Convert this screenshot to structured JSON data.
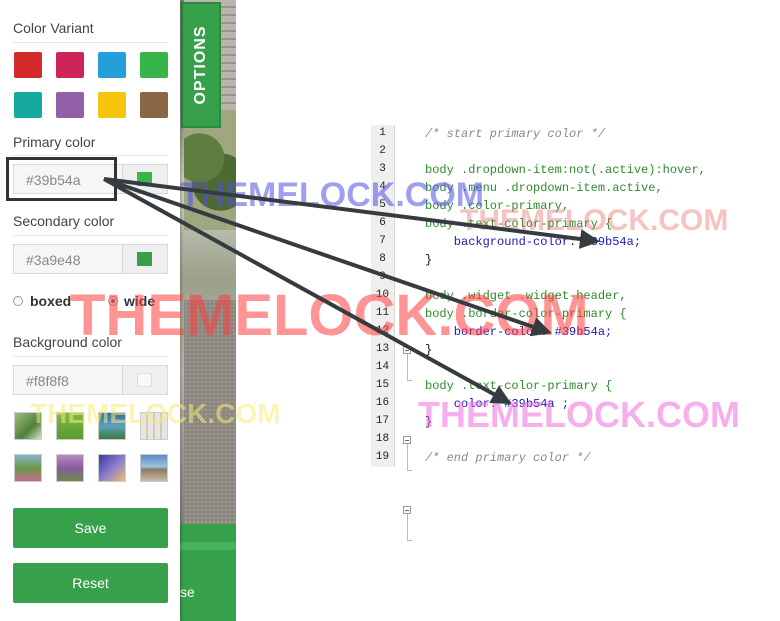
{
  "options_tab": {
    "label": "OPTIONS"
  },
  "panel": {
    "color_variant_title": "Color Variant",
    "swatches": [
      "#d42a2a",
      "#cf2457",
      "#23a0dc",
      "#36b54a",
      "#16a9a0",
      "#935fa6",
      "#f5c40c",
      "#8b6645"
    ],
    "primary": {
      "title": "Primary color",
      "value": "#39b54a",
      "chip": "#39b54a"
    },
    "secondary": {
      "title": "Secondary color",
      "value": "#3a9e48",
      "chip": "#3a9e48"
    },
    "layout": {
      "boxed_label": "boxed",
      "wide_label": "wide",
      "selected": "wide"
    },
    "background": {
      "title": "Background color",
      "value": "#f8f8f8",
      "chip": "#f8f8f8"
    },
    "save_label": "Save",
    "reset_label": "Reset"
  },
  "background_bottom_text": "se",
  "watermark": "THEMELOCK.COM",
  "code": {
    "lines": [
      {
        "n": "1",
        "t": "/* start primary color */"
      },
      {
        "n": "2",
        "t": ""
      },
      {
        "n": "3",
        "t": "body .dropdown-item:not(.active):hover,"
      },
      {
        "n": "4",
        "t": "body .menu .dropdown-item.active,"
      },
      {
        "n": "5",
        "t": "body .color-primary,"
      },
      {
        "n": "6",
        "t": "body .text-color-primary {"
      },
      {
        "n": "7",
        "t": "    background-color: #39b54a;"
      },
      {
        "n": "8",
        "t": "}"
      },
      {
        "n": "9",
        "t": ""
      },
      {
        "n": "10",
        "t": "body .widget .widget-header,"
      },
      {
        "n": "11",
        "t": "body .border-color-primary {"
      },
      {
        "n": "12",
        "t": "    border-color: #39b54a;"
      },
      {
        "n": "13",
        "t": "}"
      },
      {
        "n": "14",
        "t": ""
      },
      {
        "n": "15",
        "t": "body .text-color-primary {"
      },
      {
        "n": "16",
        "t": "    color: #39b54a ;"
      },
      {
        "n": "17",
        "t": "}"
      },
      {
        "n": "18",
        "t": ""
      },
      {
        "n": "19",
        "t": "/* end primary color */"
      }
    ]
  }
}
